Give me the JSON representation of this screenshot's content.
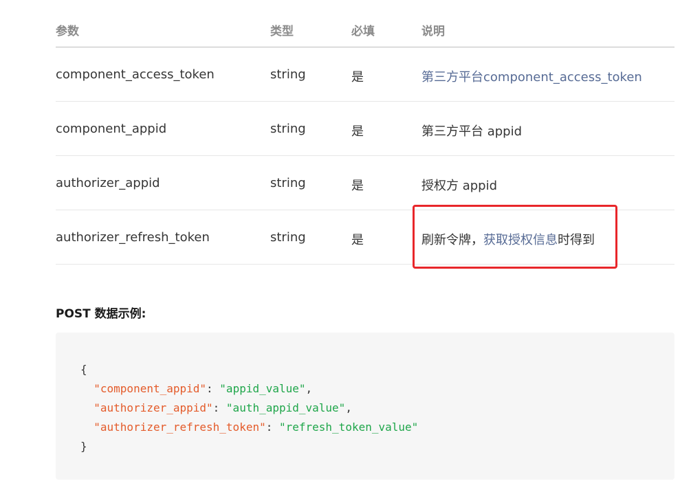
{
  "table": {
    "headers": {
      "param": "参数",
      "type": "类型",
      "required": "必填",
      "desc": "说明"
    },
    "rows": [
      {
        "param": "component_access_token",
        "type": "string",
        "required": "是",
        "desc_link": "第三方平台component_access_token"
      },
      {
        "param": "component_appid",
        "type": "string",
        "required": "是",
        "desc": "第三方平台 appid"
      },
      {
        "param": "authorizer_appid",
        "type": "string",
        "required": "是",
        "desc": "授权方 appid"
      },
      {
        "param": "authorizer_refresh_token",
        "type": "string",
        "required": "是",
        "desc_prefix": "刷新令牌，",
        "desc_link": "获取授权信息",
        "desc_suffix": "时得到"
      }
    ]
  },
  "example": {
    "title": "POST 数据示例:",
    "open_brace": "{",
    "close_brace": "}",
    "entries": [
      {
        "key": "\"component_appid\"",
        "value": "\"appid_value\"",
        "sep": ": ",
        "end": ","
      },
      {
        "key": "\"authorizer_appid\"",
        "value": "\"auth_appid_value\"",
        "sep": ": ",
        "end": ","
      },
      {
        "key": "\"authorizer_refresh_token\"",
        "value": "\"refresh_token_value\"",
        "sep": ": ",
        "end": ""
      }
    ]
  },
  "colors": {
    "link": "#576b95",
    "highlight": "#e8262a",
    "json_key": "#e45b2a",
    "json_string": "#1fa64a"
  }
}
